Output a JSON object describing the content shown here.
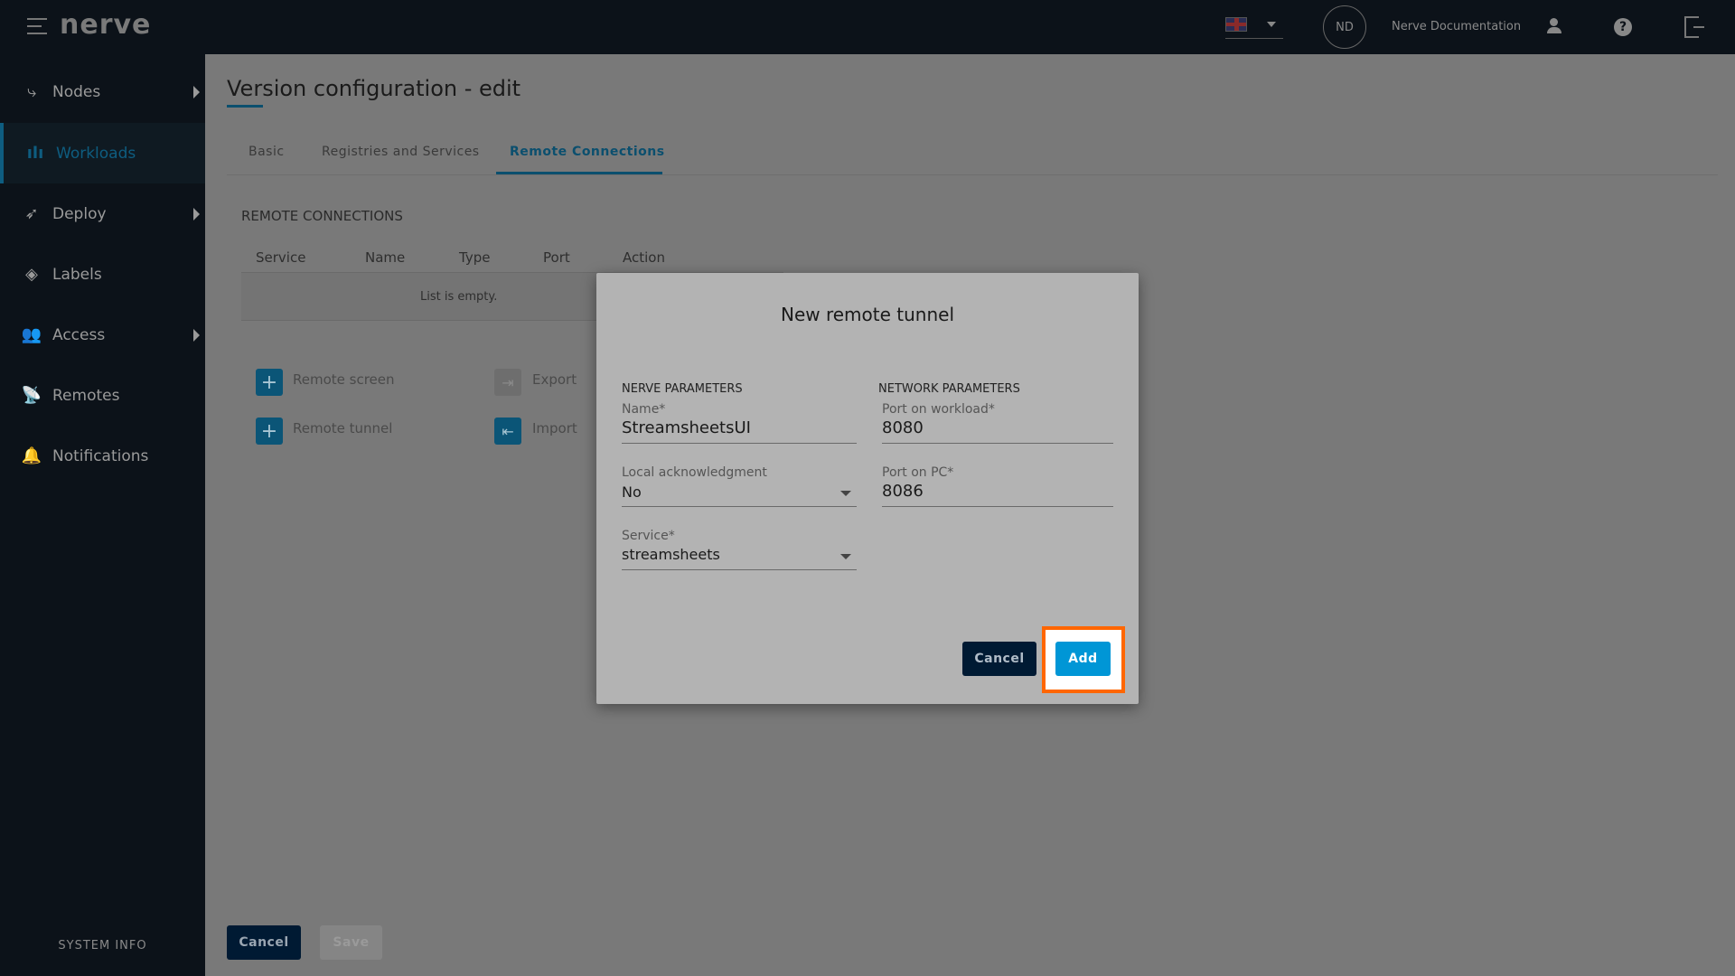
{
  "header": {
    "logo": "nerve",
    "language": "EN",
    "avatar_initials": "ND",
    "user_name": "Nerve Documentation"
  },
  "sidebar": {
    "items": [
      {
        "label": "Nodes",
        "icon": "nodes-icon",
        "has_submenu": true
      },
      {
        "label": "Workloads",
        "icon": "workloads-icon",
        "active": true
      },
      {
        "label": "Deploy",
        "icon": "rocket-icon",
        "has_submenu": true
      },
      {
        "label": "Labels",
        "icon": "tag-icon"
      },
      {
        "label": "Access",
        "icon": "users-icon",
        "has_submenu": true
      },
      {
        "label": "Remotes",
        "icon": "remote-icon"
      },
      {
        "label": "Notifications",
        "icon": "bell-icon"
      }
    ],
    "system_info": "SYSTEM INFO"
  },
  "page": {
    "title": "Version configuration - edit",
    "tabs": [
      {
        "label": "Basic"
      },
      {
        "label": "Registries and Services"
      },
      {
        "label": "Remote Connections",
        "active": true
      }
    ],
    "section_title": "REMOTE CONNECTIONS",
    "table": {
      "columns": [
        "Service",
        "Name",
        "Type",
        "Port",
        "Action"
      ],
      "empty_text": "List is empty."
    },
    "actions": {
      "remote_screen": "Remote screen",
      "remote_tunnel": "Remote tunnel",
      "export": "Export",
      "import": "Import"
    },
    "cancel": "Cancel",
    "save": "Save"
  },
  "dialog": {
    "title": "New remote tunnel",
    "nerve_params": "NERVE PARAMETERS",
    "network_params": "NETWORK PARAMETERS",
    "name_label": "Name*",
    "name_value": "StreamsheetsUI",
    "local_ack_label": "Local acknowledgment",
    "local_ack_value": "No",
    "service_label": "Service*",
    "service_value": "streamsheets",
    "port_workload_label": "Port on workload*",
    "port_workload_value": "8080",
    "port_pc_label": "Port on PC*",
    "port_pc_value": "8086",
    "cancel": "Cancel",
    "add": "Add"
  },
  "colors": {
    "accent": "#0096d6",
    "highlight": "#ff6600",
    "dark_button": "#001a33"
  }
}
